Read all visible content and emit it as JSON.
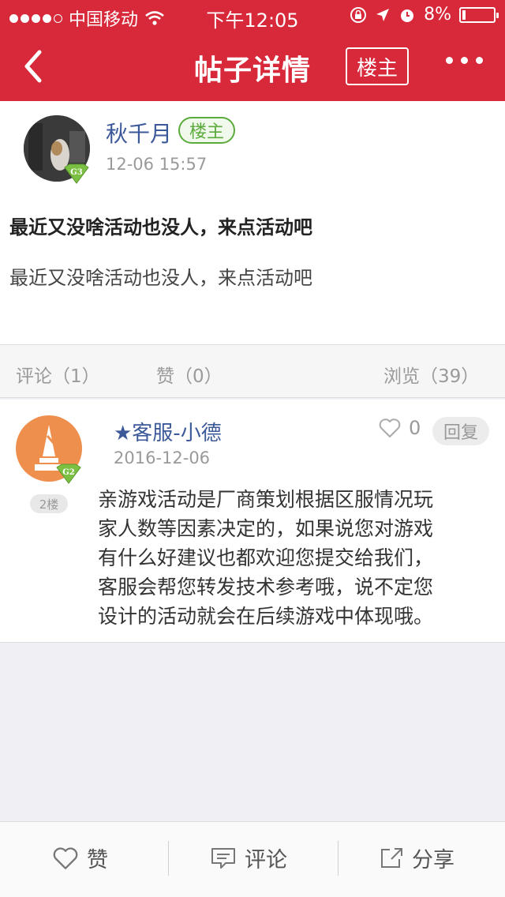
{
  "status_bar": {
    "carrier": "中国移动",
    "time": "下午12:05",
    "battery": "8%"
  },
  "nav": {
    "title": "帖子详情",
    "owner_filter": "楼主"
  },
  "post": {
    "author": "秋千月",
    "author_tag": "楼主",
    "level": "G3",
    "time": "12-06 15:57",
    "title": "最近又没啥活动也没人，来点活动吧",
    "body": "最近又没啥活动也没人，来点活动吧"
  },
  "stats": {
    "comments": "评论（1）",
    "likes": "赞（0）",
    "views": "浏览（39）"
  },
  "reply": {
    "author": "★客服-小德",
    "level": "G2",
    "floor": "2楼",
    "date": "2016-12-06",
    "like_count": "0",
    "reply_label": "回复",
    "lines": [
      "亲游戏活动是厂商策划根据区服情况玩",
      "家人数等因素决定的，如果说您对游戏",
      "有什么好建议也都欢迎您提交给我们，",
      "客服会帮您转发技术参考哦，说不定您",
      "设计的活动就会在后续游戏中体现哦。"
    ]
  },
  "bottom_bar": {
    "like": "赞",
    "comment": "评论",
    "share": "分享"
  },
  "colors": {
    "brand_red": "#d8293b",
    "name_blue": "#3b5998",
    "owner_green": "#5aab3c"
  }
}
